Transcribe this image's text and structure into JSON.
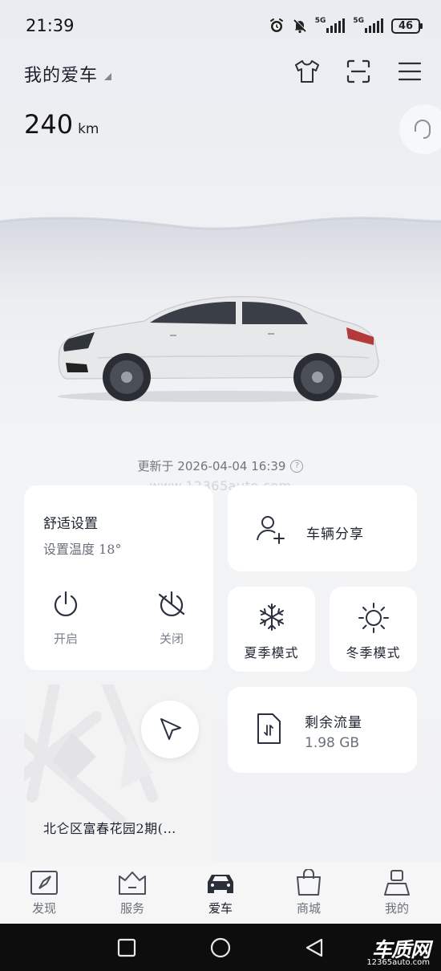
{
  "status_bar": {
    "time": "21:39",
    "icons": [
      "alarm-icon",
      "mute-icon",
      "signal-5g-icon",
      "signal-5g-icon",
      "battery-icon"
    ],
    "signal_1_label": "5G",
    "signal_2_label": "5G",
    "battery": "46"
  },
  "header": {
    "title": "我的爱车",
    "icons": [
      "shirt-icon",
      "scan-icon",
      "menu-icon"
    ]
  },
  "vehicle": {
    "mileage_value": "240",
    "mileage_unit": "km",
    "update_text": "更新于 2026-04-04 16:39",
    "help_symbol": "?",
    "watermark": "www.12365auto.com"
  },
  "comfort": {
    "title": "舒适设置",
    "subtitle": "设置温度 18°",
    "on_label": "开启",
    "off_label": "关闭"
  },
  "share": {
    "label": "车辆分享"
  },
  "modes": {
    "summer_label": "夏季模式",
    "winter_label": "冬季模式"
  },
  "map": {
    "address": "北仑区富春花园2期(…"
  },
  "data_plan": {
    "title": "剩余流量",
    "value": "1.98 GB"
  },
  "tabs": [
    {
      "label": "发现",
      "icon": "compass-icon"
    },
    {
      "label": "服务",
      "icon": "service-icon"
    },
    {
      "label": "爱车",
      "icon": "car-icon",
      "active": true
    },
    {
      "label": "商城",
      "icon": "shopping-bag-icon"
    },
    {
      "label": "我的",
      "icon": "profile-icon"
    }
  ],
  "brand": {
    "main": "车质网",
    "sub": "12365auto.com"
  },
  "colors": {
    "text_primary": "#1d2430",
    "text_secondary": "#6a707b",
    "card_bg": "#ffffff",
    "page_bg": "#eef0f3",
    "nav_bg": "#0d0d0d"
  }
}
